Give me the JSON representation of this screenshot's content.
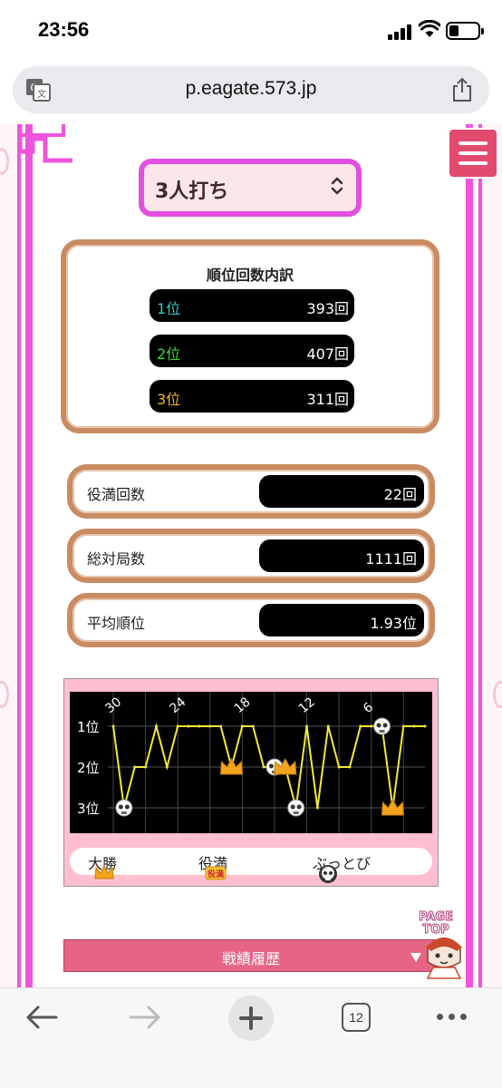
{
  "status_bar": {
    "time": "23:56"
  },
  "browser": {
    "url": "p.eagate.573.jp",
    "open_tabs": "12"
  },
  "mode_select": {
    "selected": "3人打ち"
  },
  "rank_breakdown": {
    "title": "順位回数内訳",
    "rows": [
      {
        "label": "1位",
        "value": "393回",
        "color": "#33cccc"
      },
      {
        "label": "2位",
        "value": "407回",
        "color": "#33dd33"
      },
      {
        "label": "3位",
        "value": "311回",
        "color": "#f5b52a"
      }
    ]
  },
  "stats": [
    {
      "label": "役満回数",
      "value": "22回"
    },
    {
      "label": "総対局数",
      "value": "1111回"
    },
    {
      "label": "平均順位",
      "value": "1.93位"
    }
  ],
  "chart_data": {
    "type": "line",
    "x_tick_labels": [
      "30",
      "24",
      "18",
      "12",
      "6"
    ],
    "y_tick_labels": [
      "1位",
      "2位",
      "3位"
    ],
    "ylim": [
      3,
      1
    ],
    "x": [
      30,
      29,
      28,
      27,
      26,
      25,
      24,
      23,
      22,
      21,
      20,
      19,
      18,
      17,
      16,
      15,
      14,
      13,
      12,
      11,
      10,
      9,
      8,
      7,
      6,
      5,
      4,
      3,
      2,
      1
    ],
    "values": [
      1,
      3,
      2,
      2,
      1,
      2,
      1,
      1,
      1,
      1,
      1,
      2,
      1,
      1,
      2,
      2,
      2,
      3,
      1,
      3,
      1,
      2,
      2,
      1,
      1,
      1,
      3,
      1,
      1,
      1
    ],
    "markers": [
      {
        "x": 29,
        "kind": "buttobi"
      },
      {
        "x": 19,
        "kind": "daisho"
      },
      {
        "x": 15,
        "kind": "buttobi"
      },
      {
        "x": 14,
        "kind": "daisho"
      },
      {
        "x": 13,
        "kind": "buttobi"
      },
      {
        "x": 5,
        "kind": "buttobi"
      },
      {
        "x": 4,
        "kind": "daisho"
      }
    ],
    "line_color": "#f3ea3a",
    "background": "#000000",
    "grid": true,
    "legend": [
      {
        "label": "大勝",
        "icon": "crown-icon"
      },
      {
        "label": "役満",
        "icon": "yakuman-badge-icon"
      },
      {
        "label": "ぶっとび",
        "icon": "skull-icon"
      }
    ]
  },
  "history": {
    "label": "戦績履歴"
  },
  "page_top": {
    "line1": "PAGE",
    "line2": "TOP"
  },
  "colors": {
    "accent_magenta": "#e34fe0",
    "panel_pink": "#ffbfcf",
    "bar_red": "#e66585",
    "frame_brown": "#c98b62"
  }
}
